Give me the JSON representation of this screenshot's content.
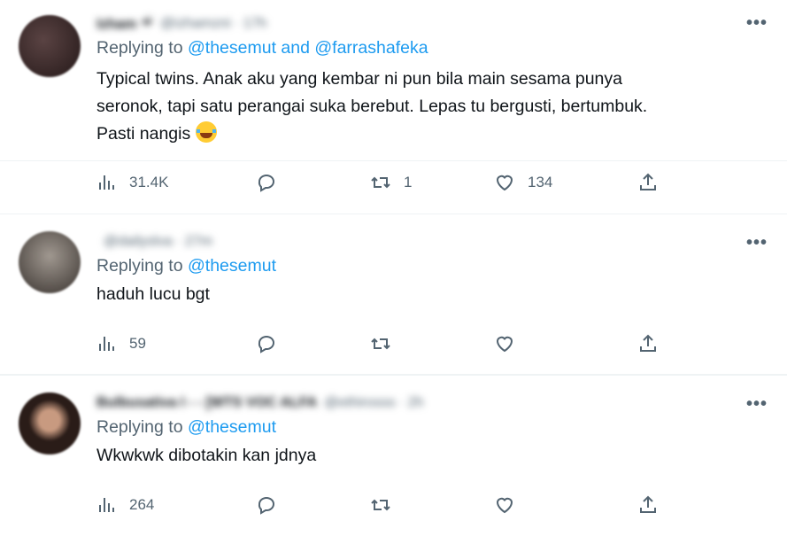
{
  "tweets": [
    {
      "name": "Izham ☔",
      "handle": "@izhamzni · 17h",
      "replying_prefix": "Replying to ",
      "mentions": "@thesemut and @farrashafeka",
      "text_lines": [
        "Typical twins. Anak aku yang kembar ni pun bila main sesama punya",
        "seronok, tapi satu perangai suka berebut. Lepas tu bergusti, bertumbuk.",
        "Pasti nangis"
      ],
      "views": "31.4K",
      "replies": "",
      "retweets": "1",
      "likes": "134",
      "avatar_color": "#3a2a2a"
    },
    {
      "name": "",
      "handle": "@dailyslva · 27m",
      "replying_prefix": "Replying to ",
      "mentions": "@thesemut",
      "text_lines": [
        "haduh lucu bgt"
      ],
      "views": "59",
      "replies": "",
      "retweets": "",
      "likes": "",
      "avatar_color": "#6b5d58"
    },
    {
      "name": "Bulbusativa I - - [WTS VOC ALFA",
      "handle": "@ethirosss · 2h",
      "replying_prefix": "Replying to ",
      "mentions": "@thesemut",
      "text_lines": [
        "Wkwkwk dibotakin kan jdnya"
      ],
      "views": "264",
      "replies": "",
      "retweets": "",
      "likes": "",
      "avatar_color": "#2a1c18"
    }
  ],
  "more_label": "•••",
  "icons": {
    "views": "views-icon",
    "reply": "reply-icon",
    "retweet": "retweet-icon",
    "like": "like-icon",
    "share": "share-icon"
  },
  "colors": {
    "accent": "#1d9bf0",
    "secondary": "#536471"
  }
}
